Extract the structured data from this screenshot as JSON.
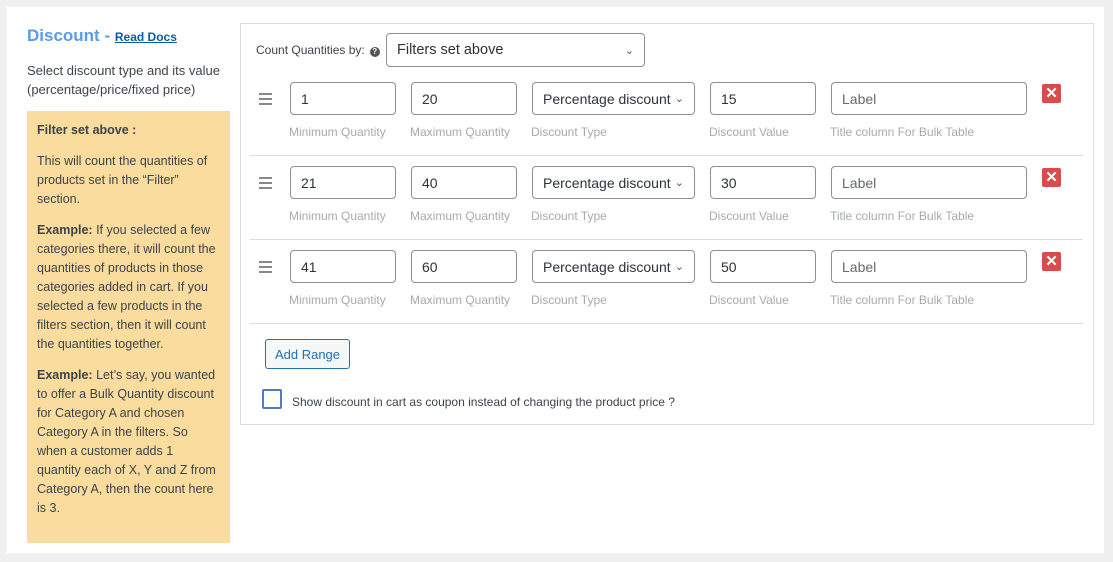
{
  "header": {
    "title": "Discount",
    "separator": "-",
    "docs_link": "Read Docs"
  },
  "description": "Select discount type and its value (percentage/price/fixed price)",
  "note": {
    "heading": "Filter set above :",
    "p1": "This will count the quantities of products set in the “Filter” section.",
    "ex1_label": "Example:",
    "ex1": " If you selected a few categories there, it will count the quantities of products in those categories added in cart. If you selected a few products in the filters section, then it will count the quantities together.",
    "ex2_label": "Example:",
    "ex2": " Let’s say, you wanted to offer a Bulk Quantity discount for Category A and chosen Category A in the filters. So when a customer adds 1 quantity each of X, Y and Z from Category A, then the count here is 3."
  },
  "count_by": {
    "label": "Count Quantities by:",
    "value": "Filters set above"
  },
  "field_labels": {
    "min": "Minimum Quantity",
    "max": "Maximum Quantity",
    "type": "Discount Type",
    "value": "Discount Value",
    "title": "Title column For Bulk Table"
  },
  "ranges": [
    {
      "min": "1",
      "max": "20",
      "type": "Percentage discount",
      "value": "15",
      "title_placeholder": "Label"
    },
    {
      "min": "21",
      "max": "40",
      "type": "Percentage discount",
      "value": "30",
      "title_placeholder": "Label"
    },
    {
      "min": "41",
      "max": "60",
      "type": "Percentage discount",
      "value": "50",
      "title_placeholder": "Label"
    }
  ],
  "add_range": "Add Range",
  "coupon_checkbox": {
    "label": "Show discount in cart as coupon instead of changing the product price ?",
    "checked": false
  }
}
